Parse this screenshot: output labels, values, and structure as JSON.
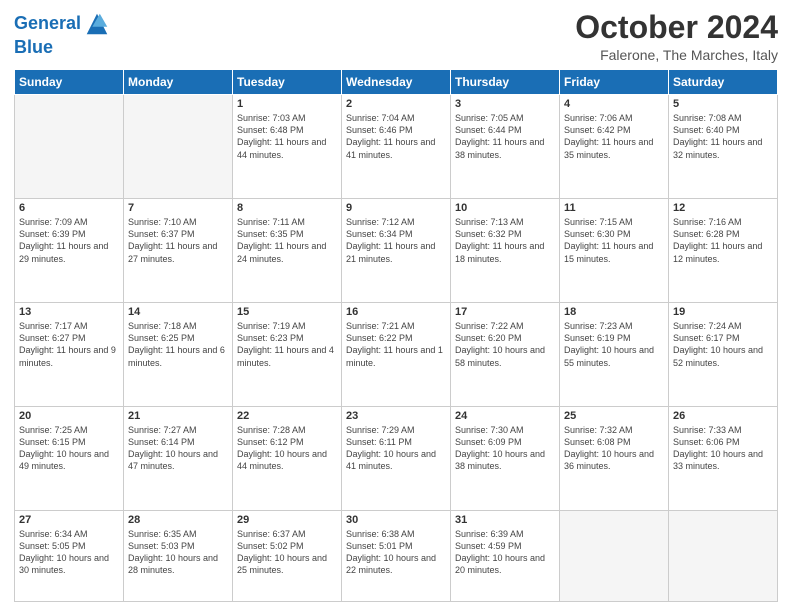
{
  "header": {
    "logo_line1": "General",
    "logo_line2": "Blue",
    "month": "October 2024",
    "location": "Falerone, The Marches, Italy"
  },
  "days_of_week": [
    "Sunday",
    "Monday",
    "Tuesday",
    "Wednesday",
    "Thursday",
    "Friday",
    "Saturday"
  ],
  "weeks": [
    [
      {
        "day": "",
        "info": ""
      },
      {
        "day": "",
        "info": ""
      },
      {
        "day": "1",
        "info": "Sunrise: 7:03 AM\nSunset: 6:48 PM\nDaylight: 11 hours and 44 minutes."
      },
      {
        "day": "2",
        "info": "Sunrise: 7:04 AM\nSunset: 6:46 PM\nDaylight: 11 hours and 41 minutes."
      },
      {
        "day": "3",
        "info": "Sunrise: 7:05 AM\nSunset: 6:44 PM\nDaylight: 11 hours and 38 minutes."
      },
      {
        "day": "4",
        "info": "Sunrise: 7:06 AM\nSunset: 6:42 PM\nDaylight: 11 hours and 35 minutes."
      },
      {
        "day": "5",
        "info": "Sunrise: 7:08 AM\nSunset: 6:40 PM\nDaylight: 11 hours and 32 minutes."
      }
    ],
    [
      {
        "day": "6",
        "info": "Sunrise: 7:09 AM\nSunset: 6:39 PM\nDaylight: 11 hours and 29 minutes."
      },
      {
        "day": "7",
        "info": "Sunrise: 7:10 AM\nSunset: 6:37 PM\nDaylight: 11 hours and 27 minutes."
      },
      {
        "day": "8",
        "info": "Sunrise: 7:11 AM\nSunset: 6:35 PM\nDaylight: 11 hours and 24 minutes."
      },
      {
        "day": "9",
        "info": "Sunrise: 7:12 AM\nSunset: 6:34 PM\nDaylight: 11 hours and 21 minutes."
      },
      {
        "day": "10",
        "info": "Sunrise: 7:13 AM\nSunset: 6:32 PM\nDaylight: 11 hours and 18 minutes."
      },
      {
        "day": "11",
        "info": "Sunrise: 7:15 AM\nSunset: 6:30 PM\nDaylight: 11 hours and 15 minutes."
      },
      {
        "day": "12",
        "info": "Sunrise: 7:16 AM\nSunset: 6:28 PM\nDaylight: 11 hours and 12 minutes."
      }
    ],
    [
      {
        "day": "13",
        "info": "Sunrise: 7:17 AM\nSunset: 6:27 PM\nDaylight: 11 hours and 9 minutes."
      },
      {
        "day": "14",
        "info": "Sunrise: 7:18 AM\nSunset: 6:25 PM\nDaylight: 11 hours and 6 minutes."
      },
      {
        "day": "15",
        "info": "Sunrise: 7:19 AM\nSunset: 6:23 PM\nDaylight: 11 hours and 4 minutes."
      },
      {
        "day": "16",
        "info": "Sunrise: 7:21 AM\nSunset: 6:22 PM\nDaylight: 11 hours and 1 minute."
      },
      {
        "day": "17",
        "info": "Sunrise: 7:22 AM\nSunset: 6:20 PM\nDaylight: 10 hours and 58 minutes."
      },
      {
        "day": "18",
        "info": "Sunrise: 7:23 AM\nSunset: 6:19 PM\nDaylight: 10 hours and 55 minutes."
      },
      {
        "day": "19",
        "info": "Sunrise: 7:24 AM\nSunset: 6:17 PM\nDaylight: 10 hours and 52 minutes."
      }
    ],
    [
      {
        "day": "20",
        "info": "Sunrise: 7:25 AM\nSunset: 6:15 PM\nDaylight: 10 hours and 49 minutes."
      },
      {
        "day": "21",
        "info": "Sunrise: 7:27 AM\nSunset: 6:14 PM\nDaylight: 10 hours and 47 minutes."
      },
      {
        "day": "22",
        "info": "Sunrise: 7:28 AM\nSunset: 6:12 PM\nDaylight: 10 hours and 44 minutes."
      },
      {
        "day": "23",
        "info": "Sunrise: 7:29 AM\nSunset: 6:11 PM\nDaylight: 10 hours and 41 minutes."
      },
      {
        "day": "24",
        "info": "Sunrise: 7:30 AM\nSunset: 6:09 PM\nDaylight: 10 hours and 38 minutes."
      },
      {
        "day": "25",
        "info": "Sunrise: 7:32 AM\nSunset: 6:08 PM\nDaylight: 10 hours and 36 minutes."
      },
      {
        "day": "26",
        "info": "Sunrise: 7:33 AM\nSunset: 6:06 PM\nDaylight: 10 hours and 33 minutes."
      }
    ],
    [
      {
        "day": "27",
        "info": "Sunrise: 6:34 AM\nSunset: 5:05 PM\nDaylight: 10 hours and 30 minutes."
      },
      {
        "day": "28",
        "info": "Sunrise: 6:35 AM\nSunset: 5:03 PM\nDaylight: 10 hours and 28 minutes."
      },
      {
        "day": "29",
        "info": "Sunrise: 6:37 AM\nSunset: 5:02 PM\nDaylight: 10 hours and 25 minutes."
      },
      {
        "day": "30",
        "info": "Sunrise: 6:38 AM\nSunset: 5:01 PM\nDaylight: 10 hours and 22 minutes."
      },
      {
        "day": "31",
        "info": "Sunrise: 6:39 AM\nSunset: 4:59 PM\nDaylight: 10 hours and 20 minutes."
      },
      {
        "day": "",
        "info": ""
      },
      {
        "day": "",
        "info": ""
      }
    ]
  ]
}
